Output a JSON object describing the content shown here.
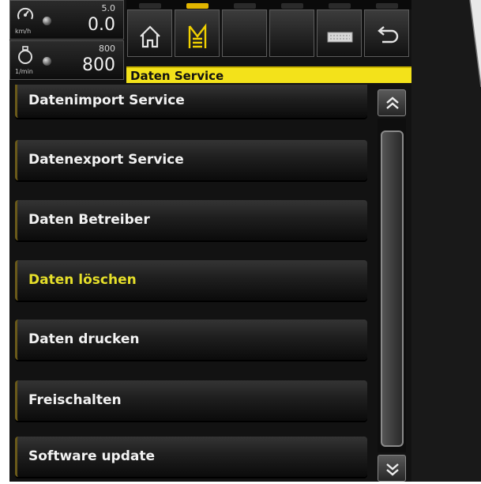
{
  "gauges": {
    "speed": {
      "limit": "5.0",
      "value": "0.0",
      "unit": "km/h",
      "icon": "speedometer-icon"
    },
    "rpm": {
      "limit": "800",
      "value": "800",
      "unit": "1/min",
      "icon": "engine-rpm-icon"
    }
  },
  "toolbar": {
    "buttons": [
      {
        "name": "home-button",
        "icon": "home-icon",
        "active": false
      },
      {
        "name": "menu-button",
        "icon": "menu-m-icon",
        "active": true
      },
      {
        "name": "empty-button-1",
        "icon": "",
        "active": false
      },
      {
        "name": "empty-button-2",
        "icon": "",
        "active": false
      },
      {
        "name": "keyboard-button",
        "icon": "keyboard-icon",
        "active": false
      },
      {
        "name": "back-button",
        "icon": "return-arrow-icon",
        "active": false
      }
    ],
    "breadcrumb": "Daten Service"
  },
  "menu": {
    "items": [
      {
        "label": "Datenimport Service",
        "highlighted": false
      },
      {
        "label": "Datenexport Service",
        "highlighted": false
      },
      {
        "label": "Daten Betreiber",
        "highlighted": false
      },
      {
        "label": "Daten löschen",
        "highlighted": true
      },
      {
        "label": "Daten drucken",
        "highlighted": false
      },
      {
        "label": "Freischalten",
        "highlighted": false
      },
      {
        "label": "Software update",
        "highlighted": false
      }
    ]
  },
  "scrollbar": {
    "up_icon": "chevron-double-up-icon",
    "down_icon": "chevron-double-down-icon"
  },
  "colors": {
    "accent": "#f3e21a",
    "highlight_text": "#e6df2a",
    "background": "#121212"
  }
}
